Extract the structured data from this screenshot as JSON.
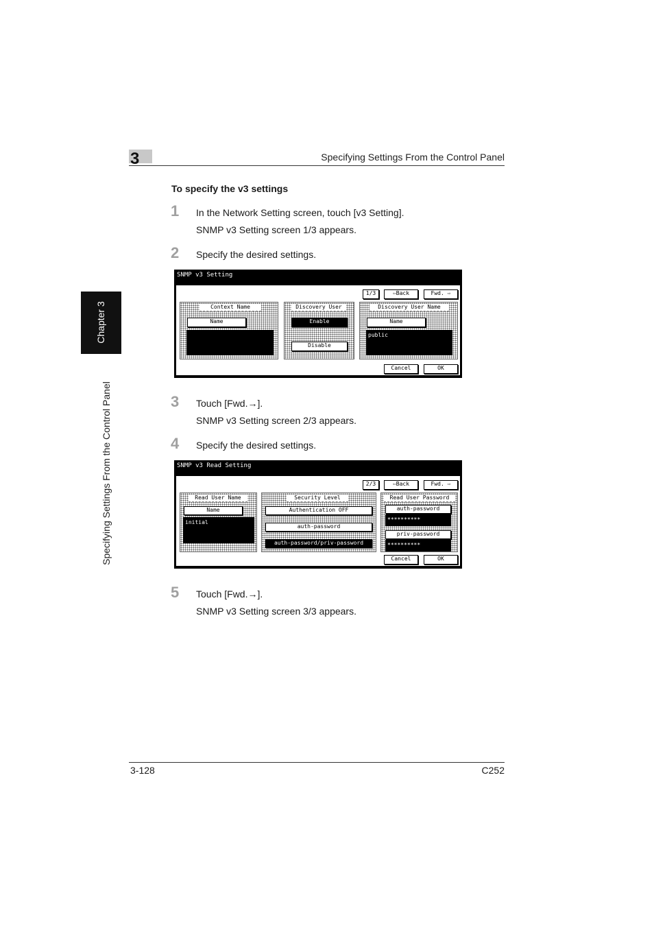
{
  "header": {
    "chapter_number": "3",
    "running_title": "Specifying Settings From the Control Panel"
  },
  "side": {
    "chapter_tab": "Chapter 3",
    "running_title": "Specifying Settings From the Control Panel"
  },
  "section_title": "To specify the v3 settings",
  "steps": [
    {
      "num": "1",
      "text": "In the Network Setting screen, touch [v3 Setting].",
      "result": "SNMP v3 Setting screen 1/3 appears."
    },
    {
      "num": "2",
      "text": "Specify the desired settings."
    },
    {
      "num": "3",
      "text": "Touch [Fwd.→].",
      "result": "SNMP v3 Setting screen 2/3 appears."
    },
    {
      "num": "4",
      "text": "Specify the desired settings."
    },
    {
      "num": "5",
      "text": "Touch [Fwd.→].",
      "result": "SNMP v3 Setting screen 3/3 appears."
    }
  ],
  "screen1": {
    "title": "SNMP v3 Setting",
    "page": "1/3",
    "back": "⇦Back",
    "fwd": "Fwd. ⇨",
    "context_name": {
      "heading": "Context Name",
      "button": "Name",
      "value": ""
    },
    "discovery_user": {
      "heading": "Discovery User",
      "enable": "Enable",
      "disable": "Disable"
    },
    "discovery_user_name": {
      "heading": "Discovery User Name",
      "button": "Name",
      "value": "public"
    },
    "cancel": "Cancel",
    "ok": "OK"
  },
  "screen2": {
    "title": "SNMP v3 Read Setting",
    "page": "2/3",
    "back": "⇦Back",
    "fwd": "Fwd. ⇨",
    "read_user_name": {
      "heading": "Read User Name",
      "button": "Name",
      "value": "initial"
    },
    "security_level": {
      "heading": "Security Level",
      "opt1": "Authentication OFF",
      "opt2": "auth-password",
      "opt3": "auth-password/priv-password"
    },
    "read_user_password": {
      "heading": "Read User Password",
      "auth_button": "auth-password",
      "auth_value": "**********",
      "priv_button": "priv-password",
      "priv_value": "**********"
    },
    "cancel": "Cancel",
    "ok": "OK"
  },
  "footer": {
    "page_number": "3-128",
    "model": "C252"
  }
}
